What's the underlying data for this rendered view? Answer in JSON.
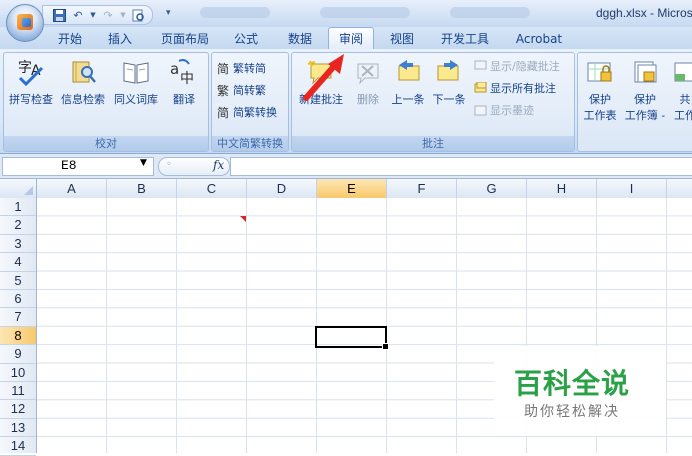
{
  "window": {
    "title": "dggh.xlsx - Microso"
  },
  "quick_access": {
    "save_icon": "save-icon",
    "undo_icon": "undo-icon",
    "redo_icon": "redo-icon",
    "print_preview_icon": "print-preview-icon",
    "customize_icon": "chevron-down-icon"
  },
  "tabs": [
    {
      "label": "开始"
    },
    {
      "label": "插入"
    },
    {
      "label": "页面布局"
    },
    {
      "label": "公式"
    },
    {
      "label": "数据"
    },
    {
      "label": "审阅",
      "active": true
    },
    {
      "label": "视图"
    },
    {
      "label": "开发工具"
    },
    {
      "label": "Acrobat"
    }
  ],
  "ribbon": {
    "proofing": {
      "label": "校对",
      "buttons": [
        {
          "label": "拼写检查"
        },
        {
          "label": "信息检索"
        },
        {
          "label": "同义词库"
        },
        {
          "label": "翻译"
        }
      ]
    },
    "chinese_conversion": {
      "label": "中文简繁转换",
      "buttons": [
        {
          "label": "繁转简"
        },
        {
          "label": "简转繁"
        },
        {
          "label": "简繁转换"
        }
      ]
    },
    "comments": {
      "label": "批注",
      "big_buttons": [
        {
          "label": "新建批注"
        },
        {
          "label": "删除"
        },
        {
          "label": "上一条"
        },
        {
          "label": "下一条"
        }
      ],
      "small_buttons": [
        {
          "label": "显示/隐藏批注"
        },
        {
          "label": "显示所有批注"
        },
        {
          "label": "显示墨迹"
        }
      ]
    },
    "changes": {
      "buttons": [
        {
          "line1": "保护",
          "line2": "工作表"
        },
        {
          "line1": "保护",
          "line2": "工作簿 -"
        },
        {
          "line1": "共",
          "line2": "工作"
        }
      ]
    }
  },
  "formula_bar": {
    "name_box": "E8",
    "fx": "fx",
    "formula": ""
  },
  "columns": [
    "A",
    "B",
    "C",
    "D",
    "E",
    "F",
    "G",
    "H",
    "I"
  ],
  "rows": [
    "1",
    "2",
    "3",
    "4",
    "5",
    "6",
    "7",
    "8",
    "9",
    "10",
    "11",
    "12",
    "13",
    "14"
  ],
  "selection": {
    "column": "E",
    "row": "8"
  },
  "watermark": {
    "title": "百科全说",
    "subtitle": "助你轻松解决"
  },
  "colors": {
    "accent": "#15428b",
    "selected_header": "#f8c96c",
    "watermark_green": "#2aa047",
    "annotation_arrow": "#e8251f"
  }
}
